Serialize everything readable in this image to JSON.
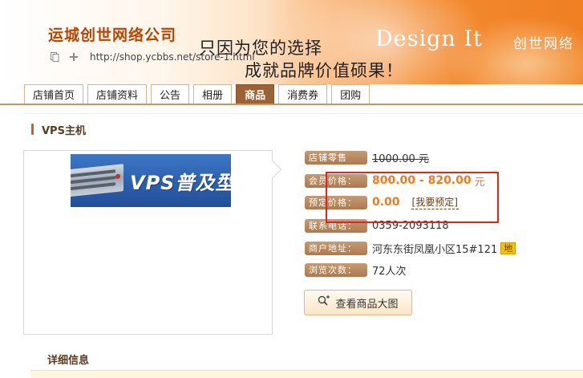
{
  "header": {
    "shop_name": "运城创世网络公司",
    "url": "http://shop.ycbbs.net/store-1.html",
    "slogan_line1": "只因为您的选择",
    "slogan_line2": "成就品牌价值硕果！",
    "design_text": "Design It",
    "design_cn": "创世网络"
  },
  "tabs": [
    {
      "label": "店铺首页"
    },
    {
      "label": "店铺资料"
    },
    {
      "label": "公告"
    },
    {
      "label": "相册"
    },
    {
      "label": "商品"
    },
    {
      "label": "消费券"
    },
    {
      "label": "团购"
    }
  ],
  "active_tab": "商品",
  "product": {
    "title": "VPS主机",
    "image_label": "VPS普及型",
    "store_price_label": "店铺零售",
    "store_price": "1000.00 元",
    "member_price_label": "会员价格：",
    "member_price": "800.00 - 820.00",
    "currency": "元",
    "reserve_price_label": "预定价格：",
    "reserve_price": "0.00",
    "reserve_link": "[我要预定]",
    "phone_label": "联系电话：",
    "phone": "0359-2093118",
    "address_label": "商户地址：",
    "address": "河东东街凤凰小区15#121",
    "map_badge": "地",
    "views_label": "浏览次数：",
    "views": "72人次",
    "view_image_button": "查看商品大图"
  },
  "details_title": "详细信息",
  "colors": {
    "accent": "#f07b1c",
    "tab_active": "#9b6236",
    "highlight": "#e0251b"
  }
}
